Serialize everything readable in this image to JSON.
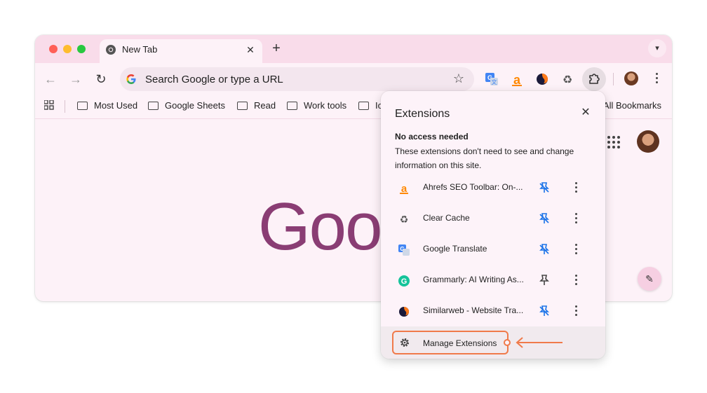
{
  "tab": {
    "title": "New Tab"
  },
  "omnibox": {
    "placeholder": "Search Google or type a URL"
  },
  "bookmarks": {
    "items": [
      "Most Used",
      "Google Sheets",
      "Read",
      "Work tools",
      "Io"
    ],
    "all_label": "All Bookmarks"
  },
  "logo_text": "Goog",
  "extensions_popup": {
    "title": "Extensions",
    "section_heading": "No access needed",
    "section_description": "These extensions don't need to see and change information on this site.",
    "items": [
      {
        "name": "Ahrefs SEO Toolbar: On-...",
        "icon": "ahrefs-icon",
        "pinned": true
      },
      {
        "name": "Clear Cache",
        "icon": "recycle-icon",
        "pinned": true
      },
      {
        "name": "Google Translate",
        "icon": "google-translate-icon",
        "pinned": true
      },
      {
        "name": "Grammarly: AI Writing As...",
        "icon": "grammarly-icon",
        "pinned": false
      },
      {
        "name": "Similarweb - Website Tra...",
        "icon": "similarweb-icon",
        "pinned": true
      }
    ],
    "manage_label": "Manage Extensions"
  },
  "colors": {
    "accent_orange": "#f07a4a",
    "tab_strip": "#f9dcea",
    "google_logo": "#8a3d74"
  }
}
